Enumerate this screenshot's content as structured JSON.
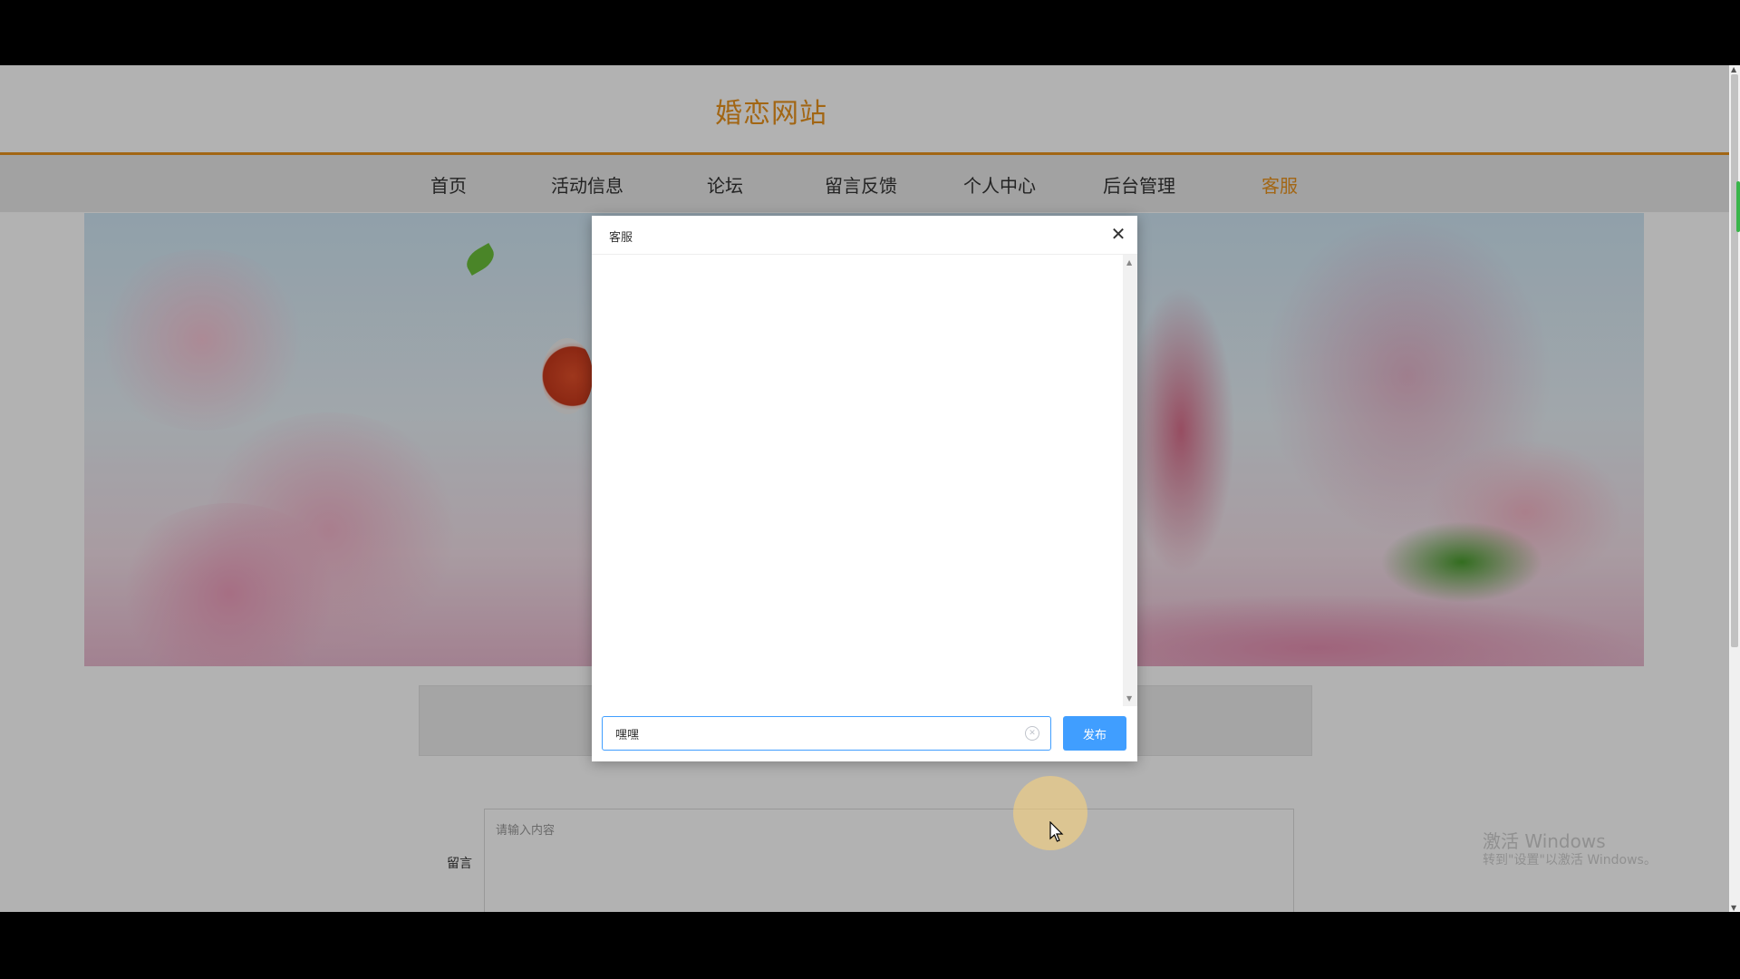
{
  "site": {
    "title": "婚恋网站"
  },
  "nav": {
    "items": [
      {
        "label": "首页",
        "active": false
      },
      {
        "label": "活动信息",
        "active": false
      },
      {
        "label": "论坛",
        "active": false
      },
      {
        "label": "留言反馈",
        "active": false
      },
      {
        "label": "个人中心",
        "active": false
      },
      {
        "label": "后台管理",
        "active": false
      },
      {
        "label": "客服",
        "active": true
      }
    ]
  },
  "message_form": {
    "label": "留言",
    "placeholder": "请输入内容"
  },
  "dialog": {
    "title": "客服",
    "close_icon": "close-icon",
    "input_value": "嘿嘿",
    "send_label": "发布"
  },
  "watermark": {
    "line1": "激活 Windows",
    "line2": "转到\"设置\"以激活 Windows。"
  },
  "colors": {
    "brand": "#e8921e",
    "primary_button": "#409eff",
    "nav_background": "#e8e8e8"
  }
}
